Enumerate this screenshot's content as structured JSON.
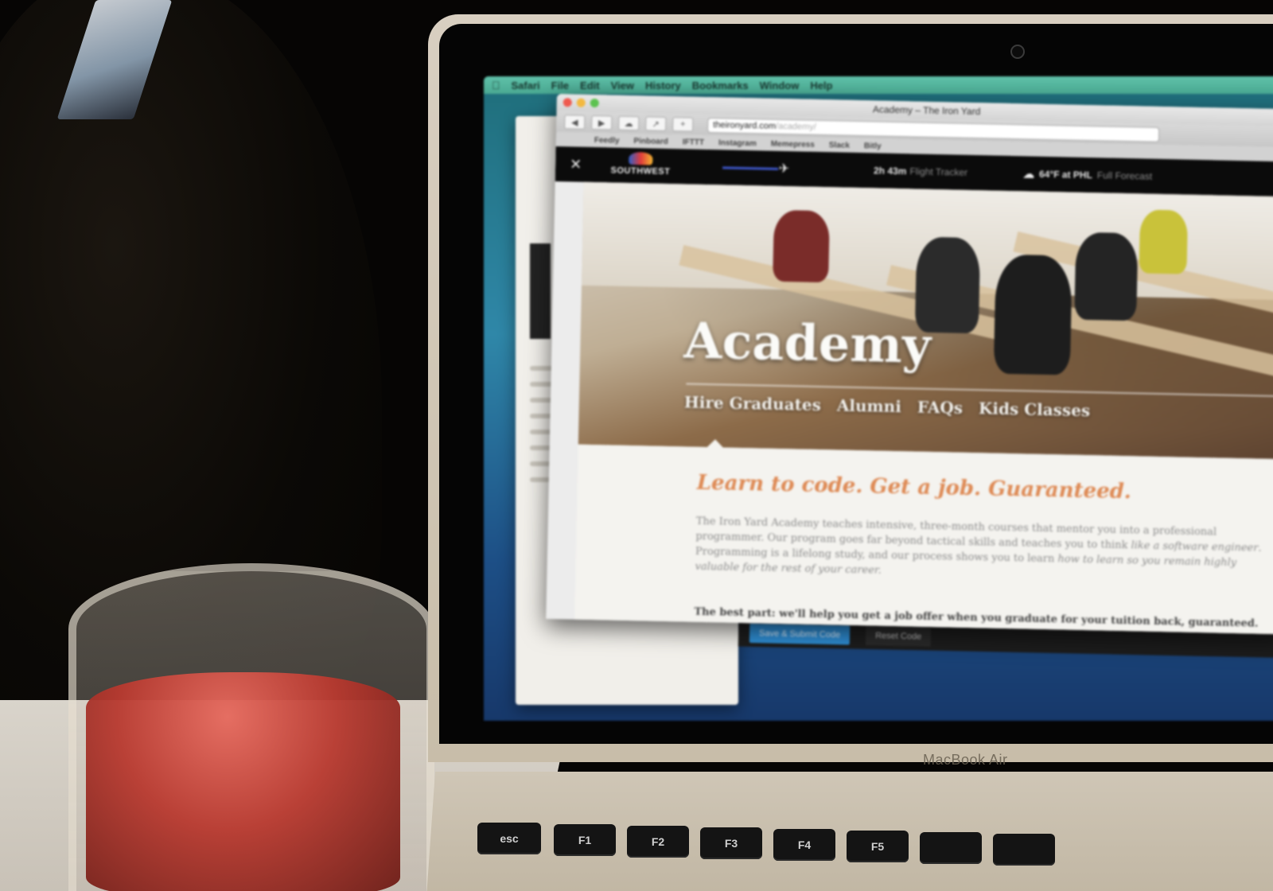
{
  "menubar": {
    "items": [
      "Safari",
      "File",
      "Edit",
      "View",
      "History",
      "Bookmarks",
      "Window",
      "Help"
    ]
  },
  "browser": {
    "window_title": "Academy – The Iron Yard",
    "url_host": "theironyard.com",
    "url_path": "/academy/",
    "bookmarks": [
      "Feedly",
      "Pinboard",
      "IFTTT",
      "Instagram",
      "Memepress",
      "Slack",
      "Bitly"
    ]
  },
  "wifi_bar": {
    "logo_text": "SOUTHWEST",
    "flight_time": "2h 43m",
    "flight_time_label": "Flight Tracker",
    "weather": "64°F at PHL",
    "weather_label": "Full Forecast"
  },
  "hero": {
    "title": "Academy",
    "nav": [
      "Hire Graduates",
      "Alumni",
      "FAQs",
      "Kids Classes"
    ]
  },
  "content": {
    "tagline": "Learn to code. Get a job. Guaranteed.",
    "paragraph_main": "The Iron Yard Academy teaches intensive, three-month courses that mentor you into a professional programmer. Our program goes far beyond tactical skills and teaches you to think ",
    "paragraph_em1": "like a software engineer",
    "paragraph_mid": ". Programming is a lifelong study, and our process shows you to learn ",
    "paragraph_em2": "how to learn so you remain highly valuable for the rest of your career.",
    "bottom_line": "The best part: we'll help you get a job offer when you graduate for your tuition back, guaranteed."
  },
  "editor_bar": {
    "save_button": "Save & Submit Code",
    "reset_button": "Reset Code"
  },
  "laptop": {
    "brand": "MacBook Air",
    "keys": [
      "esc",
      "F1",
      "F2",
      "F3",
      "F4",
      "F5"
    ]
  },
  "colors": {
    "tagline_orange": "#de8a55",
    "menubar_teal": "#5fc1a9",
    "submit_blue": "#2f8fd6"
  }
}
